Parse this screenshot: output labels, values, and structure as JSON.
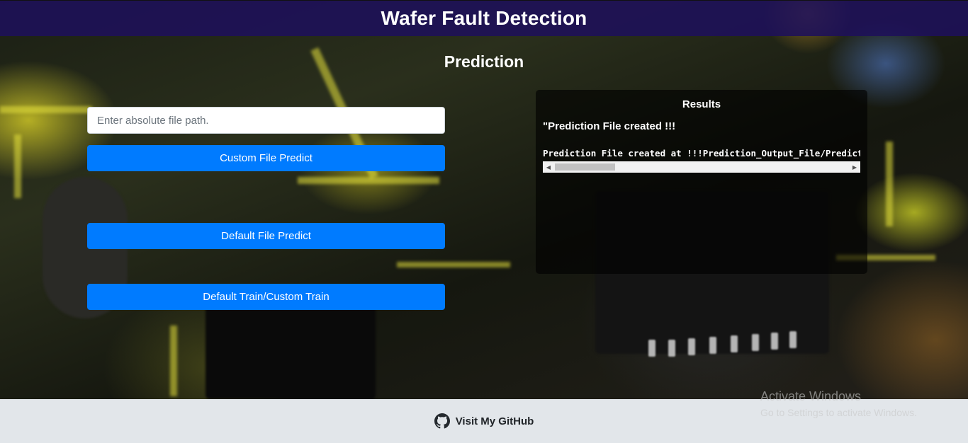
{
  "header": {
    "title": "Wafer Fault Detection"
  },
  "main": {
    "subtitle": "Prediction",
    "file_path_input": {
      "placeholder": "Enter absolute file path.",
      "value": ""
    },
    "buttons": {
      "custom_predict": "Custom File Predict",
      "default_predict": "Default File Predict",
      "train": "Default Train/Custom Train"
    }
  },
  "results": {
    "title": "Results",
    "message": "\"Prediction File created !!!",
    "output": "Prediction File created at !!!Prediction_Output_File/Predictions.csv"
  },
  "footer": {
    "github_link": "Visit My GitHub",
    "icon": "github-icon"
  },
  "watermark": {
    "line1": "Activate Windows",
    "line2": "Go to Settings to activate Windows."
  },
  "colors": {
    "navbar": "#1e105a",
    "button": "#007bff",
    "footer": "#e2e6ea"
  }
}
